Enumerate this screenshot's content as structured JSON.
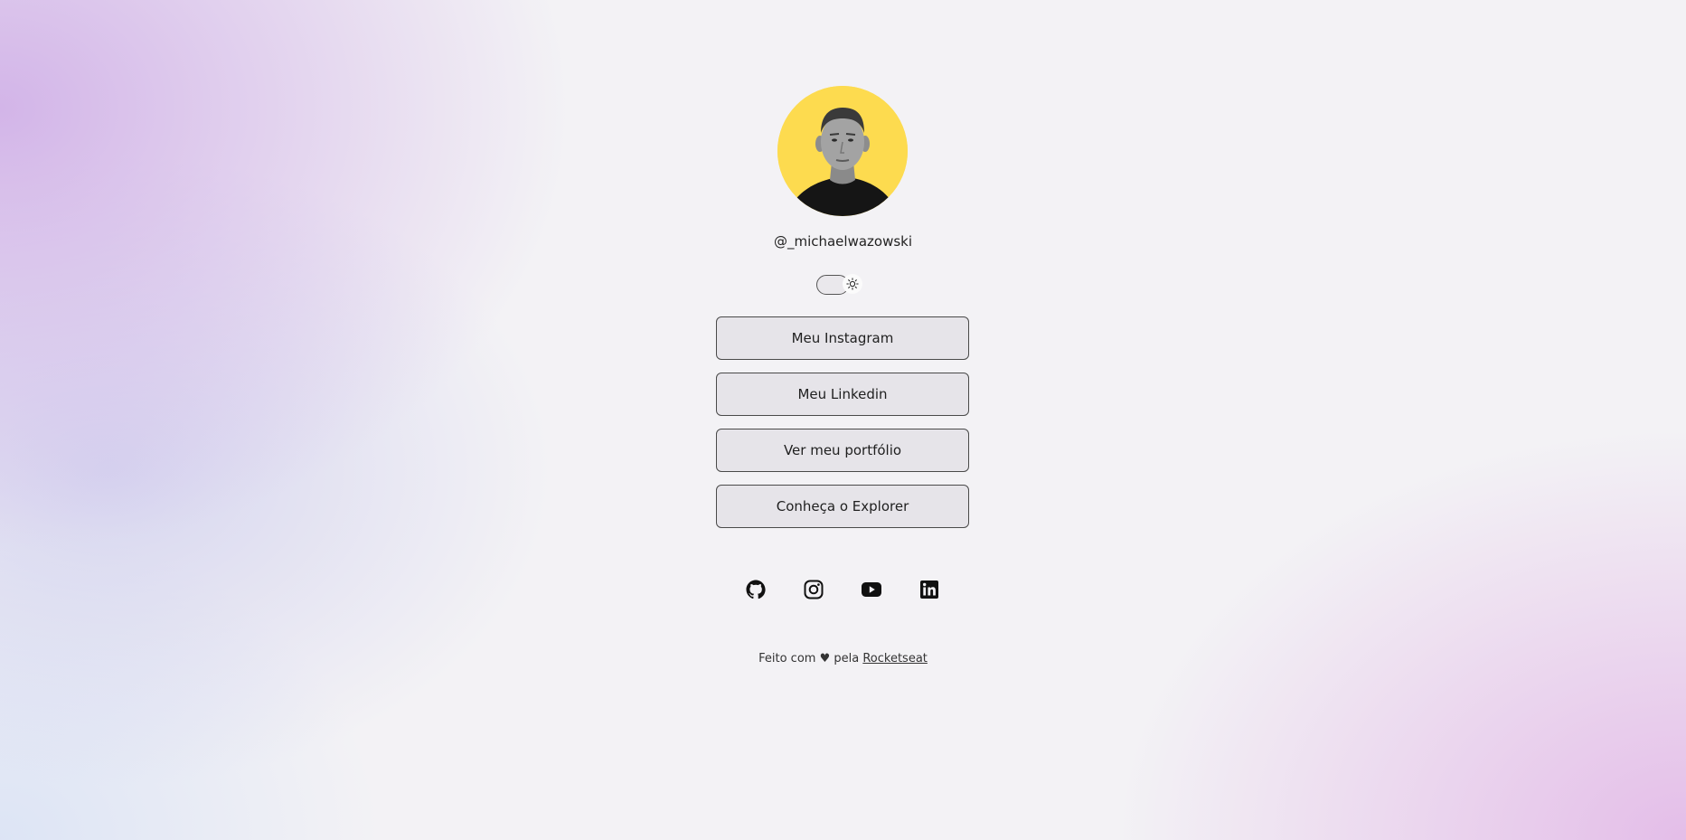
{
  "profile": {
    "username": "@_michaelwazowski",
    "avatar_bg": "#fddb4f"
  },
  "theme_toggle": {
    "icon": "sun-icon",
    "mode": "light"
  },
  "links": [
    {
      "label": "Meu Instagram"
    },
    {
      "label": "Meu Linkedin"
    },
    {
      "label": "Ver meu portfólio"
    },
    {
      "label": "Conheça o Explorer"
    }
  ],
  "socials": [
    {
      "icon": "github-icon"
    },
    {
      "icon": "instagram-icon"
    },
    {
      "icon": "youtube-icon"
    },
    {
      "icon": "linkedin-icon"
    }
  ],
  "footer": {
    "prefix": "Feito com",
    "heart": "♥",
    "middle": "pela",
    "link": "Rocketseat"
  }
}
